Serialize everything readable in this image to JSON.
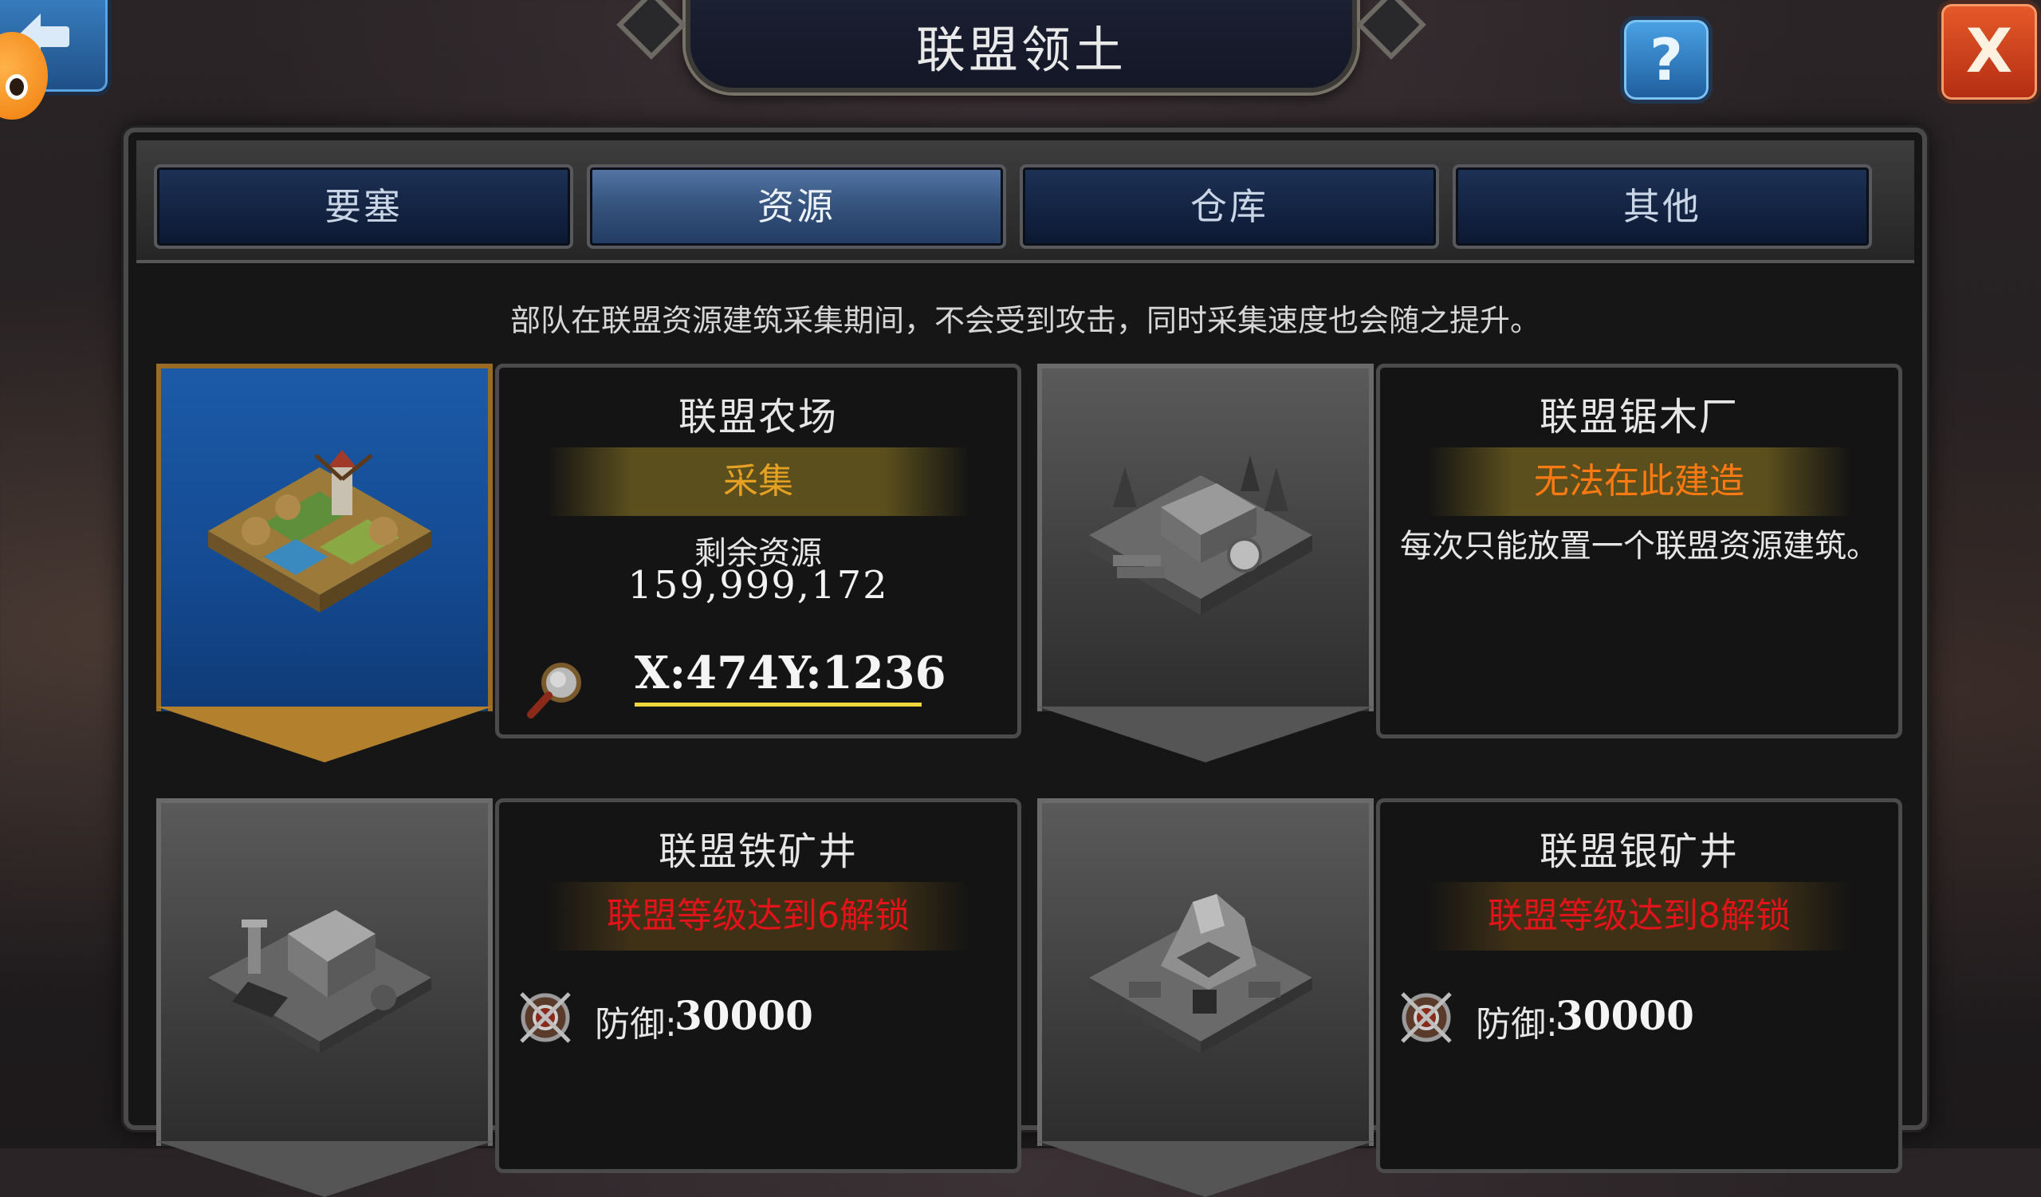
{
  "header": {
    "title": "联盟领土",
    "help_label": "?",
    "close_label": "X"
  },
  "tabs": [
    {
      "label": "要塞",
      "active": false
    },
    {
      "label": "资源",
      "active": true
    },
    {
      "label": "仓库",
      "active": false
    },
    {
      "label": "其他",
      "active": false
    }
  ],
  "hint": "部队在联盟资源建筑采集期间，不会受到攻击，同时采集速度也会随之提升。",
  "cards": [
    {
      "name": "联盟农场",
      "status": "采集",
      "remain_label": "剩余资源",
      "remain_value": "159,999,172",
      "coords": "X:474Y:1236",
      "banner": "blue"
    },
    {
      "name": "联盟锯木厂",
      "status": "无法在此建造",
      "description": "每次只能放置一个联盟资源建筑。",
      "banner": "gray"
    },
    {
      "name": "联盟铁矿井",
      "status": "联盟等级达到6解锁",
      "defense_label": "防御:",
      "defense_value": "30000",
      "banner": "gray"
    },
    {
      "name": "联盟银矿井",
      "status": "联盟等级达到8解锁",
      "defense_label": "防御:",
      "defense_value": "30000",
      "banner": "gray"
    }
  ],
  "colors": {
    "gather": "#e6a123",
    "cannot_build": "#ff7a12",
    "locked": "#e2141a",
    "coord_underline": "#f1d83a"
  }
}
